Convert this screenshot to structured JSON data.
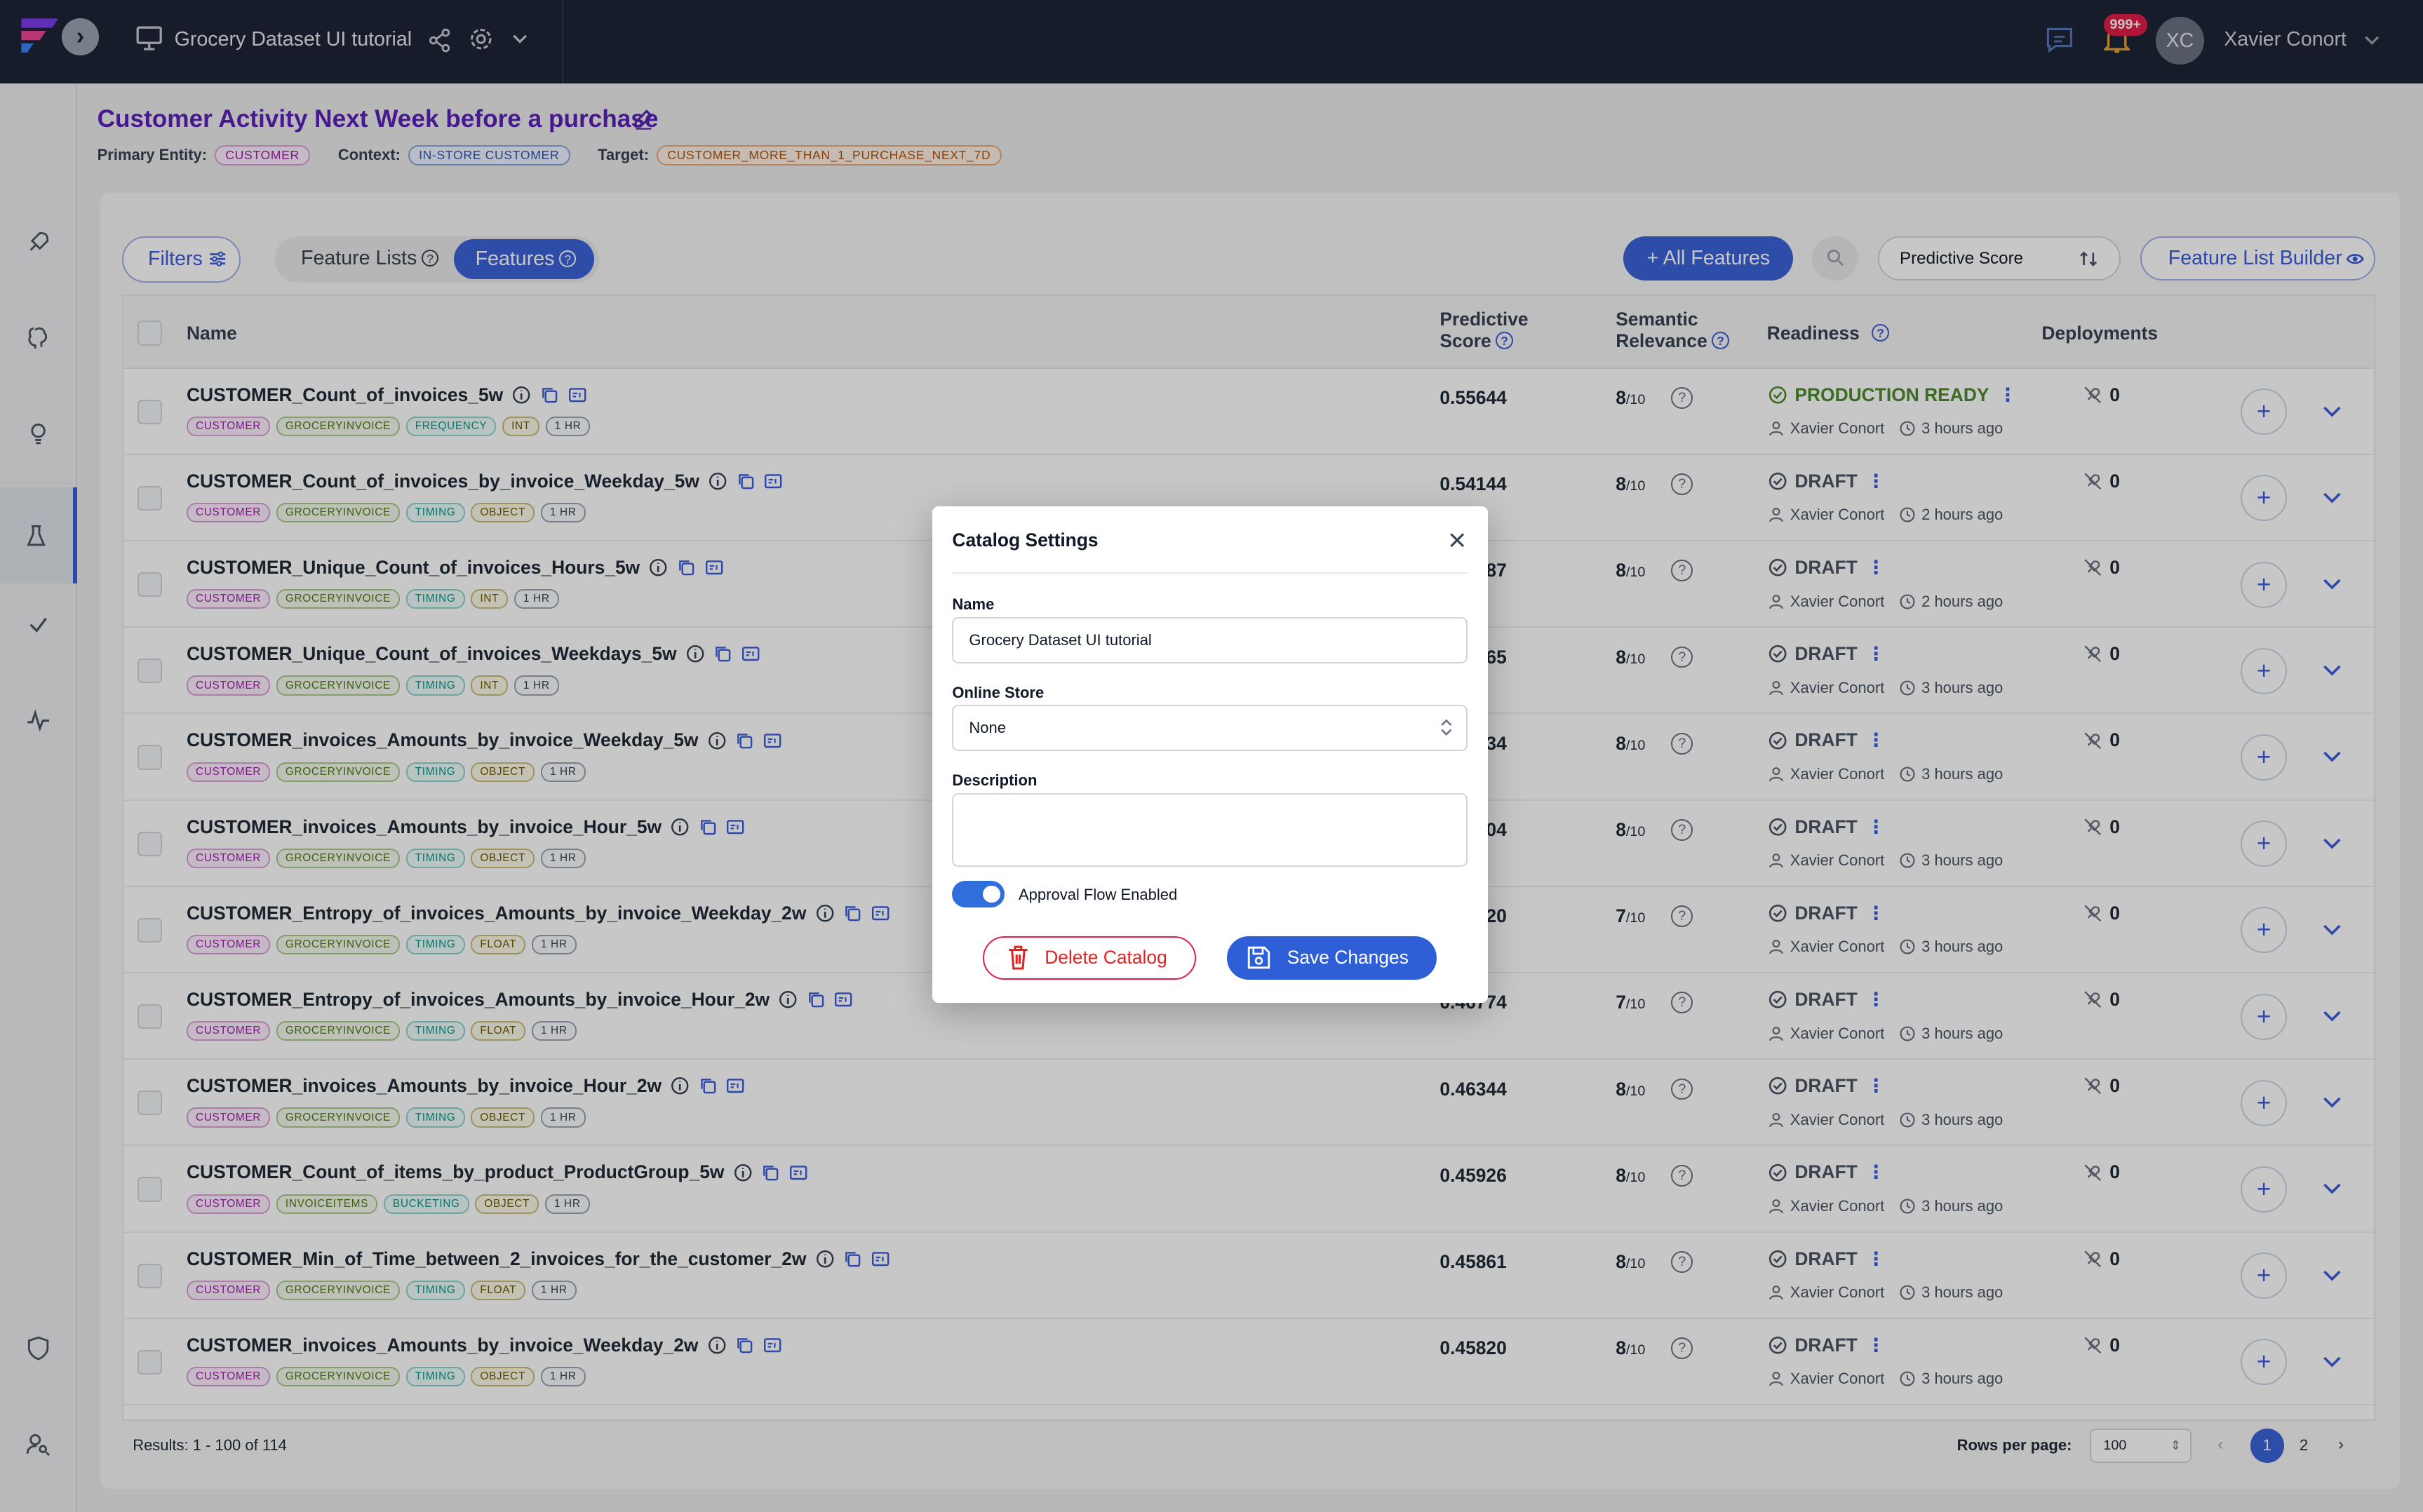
{
  "topbar": {
    "app_title": "Grocery Dataset UI tutorial",
    "notification_count": "999+",
    "avatar_initials": "XC",
    "user_name": "Xavier Conort"
  },
  "header": {
    "title": "Customer Activity Next Week before a purchase",
    "primary_entity_label": "Primary Entity:",
    "primary_entity": "CUSTOMER",
    "context_label": "Context:",
    "context": "IN-STORE CUSTOMER",
    "target_label": "Target:",
    "target": "CUSTOMER_MORE_THAN_1_PURCHASE_NEXT_7D"
  },
  "toolbar": {
    "filters": "Filters",
    "tab_feature_lists": "Feature Lists",
    "tab_features": "Features",
    "all_features": "+ All Features",
    "sort_value": "Predictive Score",
    "feature_list_builder": "Feature List Builder"
  },
  "table": {
    "headers": {
      "name": "Name",
      "predictive_score_1": "Predictive",
      "predictive_score_2": "Score",
      "semantic_relevance_1": "Semantic",
      "semantic_relevance_2": "Relevance",
      "readiness": "Readiness",
      "deployments": "Deployments"
    },
    "rows": [
      {
        "name": "CUSTOMER_Count_of_invoices_5w",
        "tags": [
          "CUSTOMER",
          "GROCERYINVOICE",
          "FREQUENCY",
          "INT",
          "1 HR"
        ],
        "score": "0.55644",
        "sem": "8",
        "readiness": "PRODUCTION READY",
        "owner": "Xavier Conort",
        "time": "3 hours ago",
        "deployments": "0"
      },
      {
        "name": "CUSTOMER_Count_of_invoices_by_invoice_Weekday_5w",
        "tags": [
          "CUSTOMER",
          "GROCERYINVOICE",
          "TIMING",
          "OBJECT",
          "1 HR"
        ],
        "score": "0.54144",
        "sem": "8",
        "readiness": "DRAFT",
        "owner": "Xavier Conort",
        "time": "2 hours ago",
        "deployments": "0"
      },
      {
        "name": "CUSTOMER_Unique_Count_of_invoices_Hours_5w",
        "tags": [
          "CUSTOMER",
          "GROCERYINVOICE",
          "TIMING",
          "INT",
          "1 HR"
        ],
        "score": "0.53187",
        "sem": "8",
        "readiness": "DRAFT",
        "owner": "Xavier Conort",
        "time": "2 hours ago",
        "deployments": "0"
      },
      {
        "name": "CUSTOMER_Unique_Count_of_invoices_Weekdays_5w",
        "tags": [
          "CUSTOMER",
          "GROCERYINVOICE",
          "TIMING",
          "INT",
          "1 HR"
        ],
        "score": "0.52765",
        "sem": "8",
        "readiness": "DRAFT",
        "owner": "Xavier Conort",
        "time": "3 hours ago",
        "deployments": "0"
      },
      {
        "name": "CUSTOMER_invoices_Amounts_by_invoice_Weekday_5w",
        "tags": [
          "CUSTOMER",
          "GROCERYINVOICE",
          "TIMING",
          "OBJECT",
          "1 HR"
        ],
        "score": "0.51534",
        "sem": "8",
        "readiness": "DRAFT",
        "owner": "Xavier Conort",
        "time": "3 hours ago",
        "deployments": "0"
      },
      {
        "name": "CUSTOMER_invoices_Amounts_by_invoice_Hour_5w",
        "tags": [
          "CUSTOMER",
          "GROCERYINVOICE",
          "TIMING",
          "OBJECT",
          "1 HR"
        ],
        "score": "0.51204",
        "sem": "8",
        "readiness": "DRAFT",
        "owner": "Xavier Conort",
        "time": "3 hours ago",
        "deployments": "0"
      },
      {
        "name": "CUSTOMER_Entropy_of_invoices_Amounts_by_invoice_Weekday_2w",
        "tags": [
          "CUSTOMER",
          "GROCERYINVOICE",
          "TIMING",
          "FLOAT",
          "1 HR"
        ],
        "score": "0.47720",
        "sem": "7",
        "readiness": "DRAFT",
        "owner": "Xavier Conort",
        "time": "3 hours ago",
        "deployments": "0"
      },
      {
        "name": "CUSTOMER_Entropy_of_invoices_Amounts_by_invoice_Hour_2w",
        "tags": [
          "CUSTOMER",
          "GROCERYINVOICE",
          "TIMING",
          "FLOAT",
          "1 HR"
        ],
        "score": "0.46774",
        "sem": "7",
        "readiness": "DRAFT",
        "owner": "Xavier Conort",
        "time": "3 hours ago",
        "deployments": "0"
      },
      {
        "name": "CUSTOMER_invoices_Amounts_by_invoice_Hour_2w",
        "tags": [
          "CUSTOMER",
          "GROCERYINVOICE",
          "TIMING",
          "OBJECT",
          "1 HR"
        ],
        "score": "0.46344",
        "sem": "8",
        "readiness": "DRAFT",
        "owner": "Xavier Conort",
        "time": "3 hours ago",
        "deployments": "0"
      },
      {
        "name": "CUSTOMER_Count_of_items_by_product_ProductGroup_5w",
        "tags": [
          "CUSTOMER",
          "INVOICEITEMS",
          "BUCKETING",
          "OBJECT",
          "1 HR"
        ],
        "score": "0.45926",
        "sem": "8",
        "readiness": "DRAFT",
        "owner": "Xavier Conort",
        "time": "3 hours ago",
        "deployments": "0"
      },
      {
        "name": "CUSTOMER_Min_of_Time_between_2_invoices_for_the_customer_2w",
        "tags": [
          "CUSTOMER",
          "GROCERYINVOICE",
          "TIMING",
          "FLOAT",
          "1 HR"
        ],
        "score": "0.45861",
        "sem": "8",
        "readiness": "DRAFT",
        "owner": "Xavier Conort",
        "time": "3 hours ago",
        "deployments": "0"
      },
      {
        "name": "CUSTOMER_invoices_Amounts_by_invoice_Weekday_2w",
        "tags": [
          "CUSTOMER",
          "GROCERYINVOICE",
          "TIMING",
          "OBJECT",
          "1 HR"
        ],
        "score": "0.45820",
        "sem": "8",
        "readiness": "DRAFT",
        "owner": "Xavier Conort",
        "time": "3 hours ago",
        "deployments": "0"
      }
    ],
    "sem_suffix": "/10"
  },
  "footer": {
    "results": "Results: 1 - 100 of 114",
    "rows_per_page_label": "Rows per page:",
    "rows_per_page": "100",
    "page_1": "1",
    "page_2": "2"
  },
  "modal": {
    "title": "Catalog Settings",
    "name_label": "Name",
    "name_value": "Grocery Dataset UI tutorial",
    "online_store_label": "Online Store",
    "online_store_value": "None",
    "description_label": "Description",
    "description_value": "",
    "approval_label": "Approval Flow Enabled",
    "approval_enabled": true,
    "delete_label": "Delete Catalog",
    "save_label": "Save Changes"
  }
}
